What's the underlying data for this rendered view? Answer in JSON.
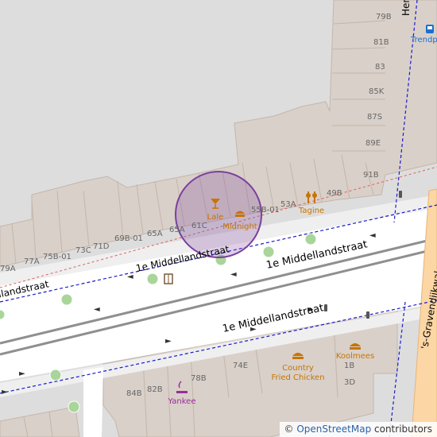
{
  "map": {
    "streets": [
      {
        "name": "1e Middellandstraat"
      },
      {
        "name": "1e Middellandstraat"
      },
      {
        "name": "1e Middellandstraat"
      },
      {
        "name": "1e Middellandstraat"
      },
      {
        "name": "'s-Gravendijkwal"
      },
      {
        "name": "Hen"
      }
    ],
    "house_numbers": [
      "79B",
      "81B",
      "83",
      "85K",
      "87S",
      "89E",
      "91B",
      "49B",
      "53A",
      "55B-01",
      "61C",
      "65A",
      "65A",
      "69B-01",
      "71D",
      "73C",
      "75B-01",
      "77A",
      "79A",
      "74E",
      "78B",
      "82B",
      "84B",
      "1B",
      "3D"
    ],
    "pois": [
      {
        "name": "Lale",
        "type": "bar-icon"
      },
      {
        "name": "Midnight",
        "type": "fast-food-icon"
      },
      {
        "name": "Tagine",
        "type": "restaurant-icon"
      },
      {
        "name": "Country Fried Chicken",
        "type": "fast-food-icon"
      },
      {
        "name": "Koolmees",
        "type": "fast-food-icon"
      },
      {
        "name": "Yankee",
        "type": "smoking-shop-icon"
      },
      {
        "name": "Trendp",
        "type": "bus-stop-icon"
      }
    ],
    "colors": {
      "background": "#dddddd",
      "building": "#d9d0c9",
      "building_outline": "#c4b6ab",
      "road": "#ffffff",
      "tram": "#8f8f8f",
      "bike_lane": "#1a1acc",
      "poi_orange": "#c77400",
      "poi_purple": "#9b2c9b",
      "highlight_circle": "#7b3f9e",
      "primary_road": "#fcd6a4"
    }
  },
  "attribution": {
    "symbol": "©",
    "link_text": "OpenStreetMap",
    "suffix": "contributors"
  }
}
